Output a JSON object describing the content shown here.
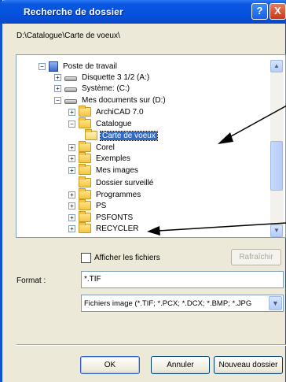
{
  "window": {
    "title": "Recherche de dossier"
  },
  "titlebar": {
    "help_glyph": "?",
    "close_glyph": "X"
  },
  "path": "D:\\Catalogue\\Carte de voeux\\",
  "tree": {
    "rows": [
      {
        "label": "Poste de travail",
        "icon": "computer-icon",
        "expander": "−",
        "selected": false
      },
      {
        "label": "Disquette 3 1/2 (A:)",
        "icon": "drive-icon",
        "expander": "+",
        "selected": false
      },
      {
        "label": "Système: (C:)",
        "icon": "drive-icon",
        "expander": "+",
        "selected": false
      },
      {
        "label": "Mes documents sur (D:)",
        "icon": "drive-icon",
        "expander": "−",
        "selected": false
      },
      {
        "label": "ArchiCAD 7.0",
        "icon": "folder-icon",
        "expander": "+",
        "selected": false
      },
      {
        "label": "Catalogue",
        "icon": "folder-icon",
        "expander": "−",
        "selected": false
      },
      {
        "label": "Carte de voeux",
        "icon": "open-folder-icon",
        "expander": "",
        "selected": true
      },
      {
        "label": "Corel",
        "icon": "folder-icon",
        "expander": "+",
        "selected": false
      },
      {
        "label": "Exemples",
        "icon": "folder-icon",
        "expander": "+",
        "selected": false
      },
      {
        "label": "Mes images",
        "icon": "folder-icon",
        "expander": "+",
        "selected": false
      },
      {
        "label": "Dossier surveillé",
        "icon": "folder-icon",
        "expander": "",
        "selected": false
      },
      {
        "label": "Programmes",
        "icon": "folder-icon",
        "expander": "+",
        "selected": false
      },
      {
        "label": "PS",
        "icon": "folder-icon",
        "expander": "+",
        "selected": false
      },
      {
        "label": "PSFONTS",
        "icon": "folder-icon",
        "expander": "+",
        "selected": false
      },
      {
        "label": "RECYCLER",
        "icon": "folder-icon",
        "expander": "+",
        "selected": false
      }
    ]
  },
  "options": {
    "show_files_label": "Afficher les fichiers",
    "refresh_label": "Rafraîchir"
  },
  "format": {
    "label": "Format :",
    "value": "*.TIF"
  },
  "filter": {
    "value": "Fichiers image (*.TIF; *.PCX; *.DCX; *.BMP; *.JPG"
  },
  "buttons": {
    "ok": "OK",
    "cancel": "Annuler",
    "new_folder": "Nouveau dossier"
  },
  "colors": {
    "titlebar": "#0a52d6",
    "selection": "#316ac5",
    "dialog_bg": "#ece9d8"
  }
}
